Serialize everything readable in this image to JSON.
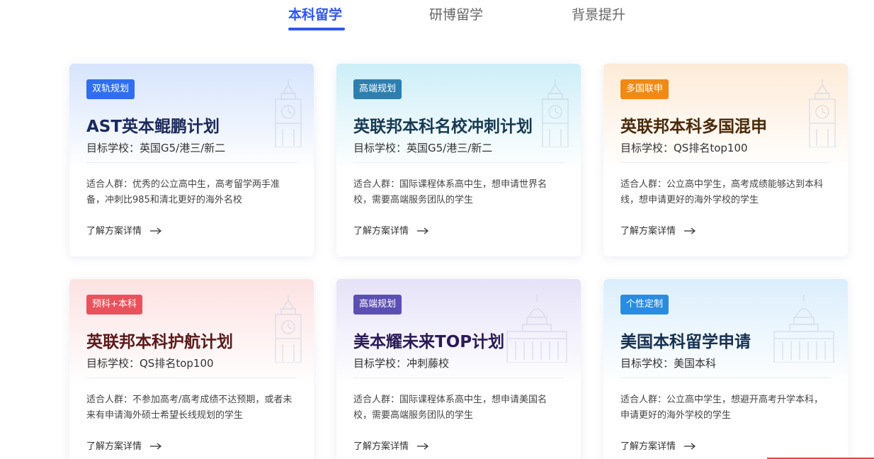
{
  "tabs": [
    {
      "label": "本科留学",
      "active": true
    },
    {
      "label": "研博留学",
      "active": false
    },
    {
      "label": "背景提升",
      "active": false
    }
  ],
  "colors": {
    "accent": "#2f55f4"
  },
  "more_label": "了解方案详情",
  "cards": [
    {
      "badge": "双轨规划",
      "badge_color": "#2f6ef0",
      "title": "AST英本鲲鹏计划",
      "title_color": "#1b2a5a",
      "target": "目标学校：英国G5/港三/新二",
      "desc": "适合人群：优秀的公立高中生，高考留学两手准备，冲刺比985和清北更好的海外名校",
      "bg": "#d6e4fc",
      "icon": "clock-tower-icon"
    },
    {
      "badge": "高端规划",
      "badge_color": "#2d7fb0",
      "title": "英联邦本科名校冲刺计划",
      "title_color": "#173a52",
      "target": "目标学校：英国G5/港三/新二",
      "desc": "适合人群：国际课程体系高中生，想申请世界名校，需要高端服务团队的学生",
      "bg": "#cdeef8",
      "icon": "clock-tower-icon"
    },
    {
      "badge": "多国联申",
      "badge_color": "#f08a14",
      "title": "英联邦本科多国混申",
      "title_color": "#4a2a0a",
      "target": "目标学校：QS排名top100",
      "desc": "适合人群：公立高中学生，高考成绩能够达到本科线，想申请更好的海外学校的学生",
      "bg": "#fdebd8",
      "icon": "clock-tower-icon"
    },
    {
      "badge": "预科+本科",
      "badge_color": "#e9525a",
      "title": "英联邦本科护航计划",
      "title_color": "#5a1a1a",
      "target": "目标学校：QS排名top100",
      "desc": "适合人群：不参加高考/高考成绩不达预期，或者未来有申请海外硕士希望长线规划的学生",
      "bg": "#fde2e2",
      "icon": "clock-tower-icon"
    },
    {
      "badge": "高端规划",
      "badge_color": "#5b4fb3",
      "title": "美本耀未来TOP计划",
      "title_color": "#2a1a55",
      "target": "目标学校：冲刺藤校",
      "desc": "适合人群：国际课程体系高中生，想申请美国名校，需要高端服务团队的学生",
      "bg": "#e6e2f8",
      "icon": "capitol-icon"
    },
    {
      "badge": "个性定制",
      "badge_color": "#2a8ce0",
      "title": "美国本科留学申请",
      "title_color": "#16314f",
      "target": "目标学校：美国本科",
      "desc": "适合人群：公立高中学生，想避开高考升学本科，申请更好的海外学校的学生",
      "bg": "#dbeefc",
      "icon": "capitol-icon"
    }
  ]
}
